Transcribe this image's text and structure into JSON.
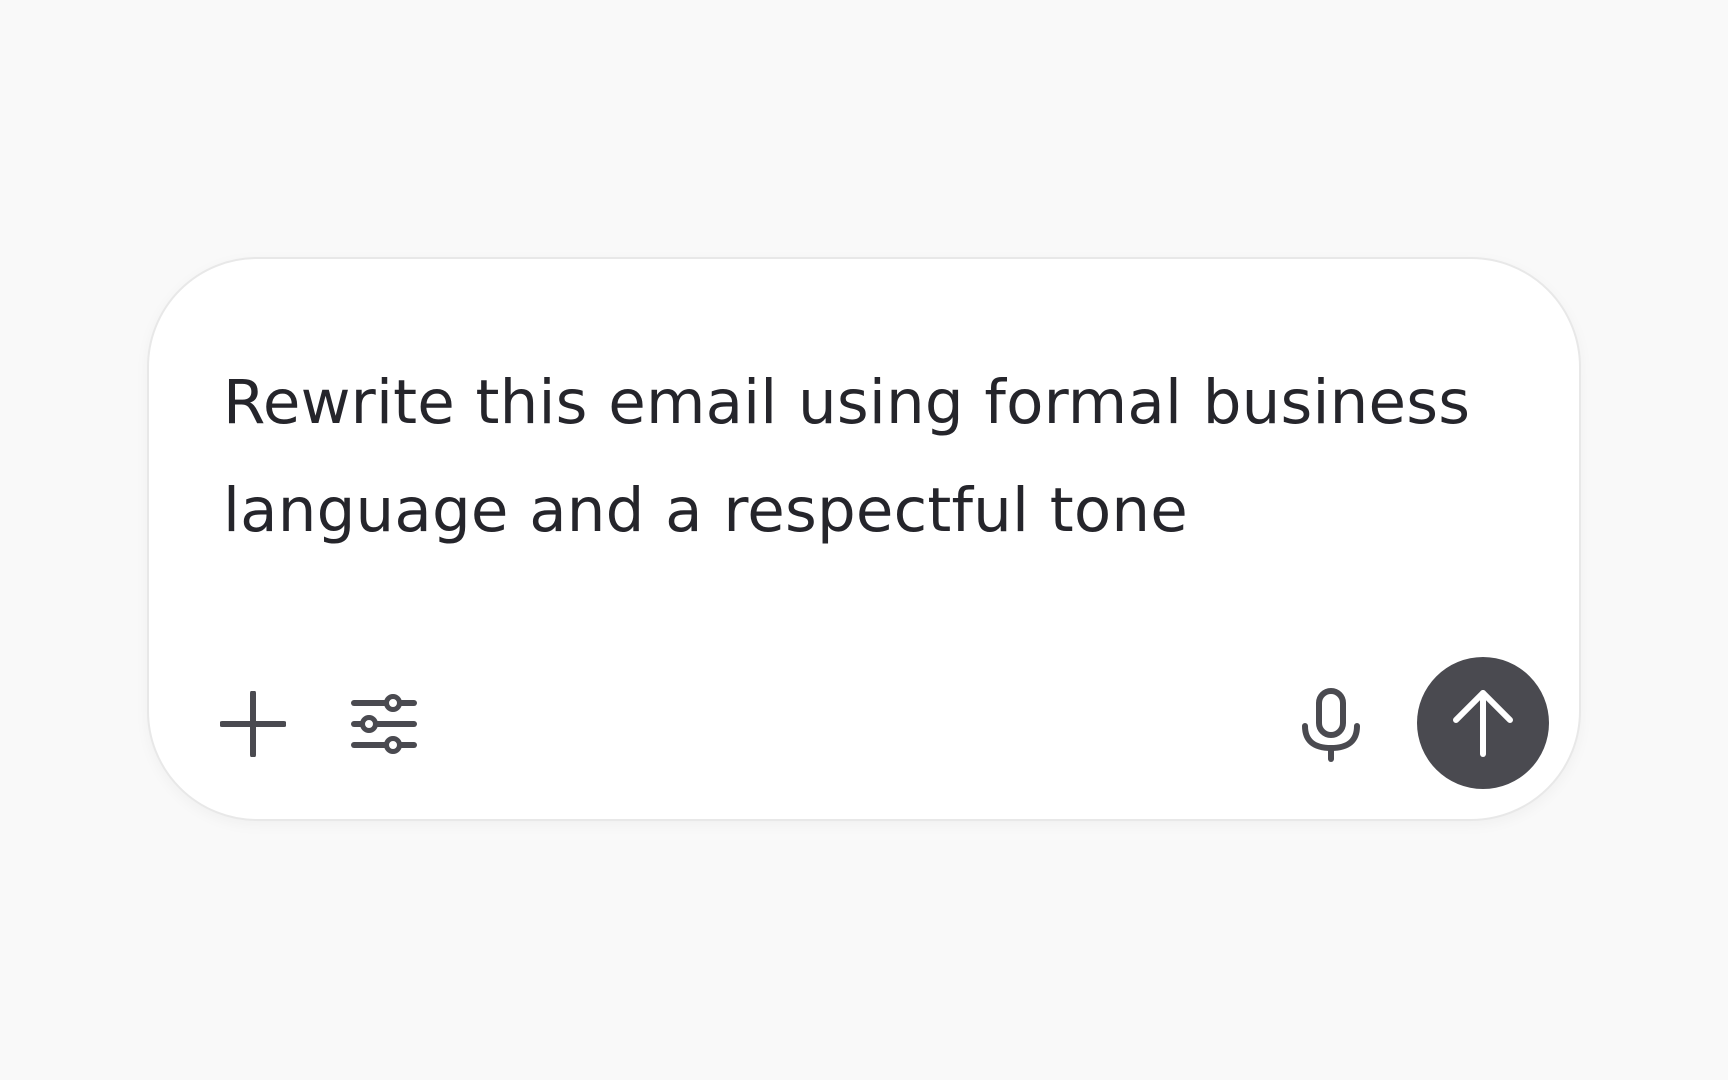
{
  "composer": {
    "prompt_text": "Rewrite this email using formal business language and a respectful tone"
  },
  "toolbar": {
    "left_icons": [
      "plus-icon",
      "sliders-icon"
    ],
    "right_icons": [
      "microphone-icon",
      "arrow-up-icon"
    ]
  },
  "colors": {
    "background": "#f9f9f9",
    "card": "#ffffff",
    "text": "#25252b",
    "icon": "#4a4a50",
    "send_button": "#4a4a50"
  }
}
